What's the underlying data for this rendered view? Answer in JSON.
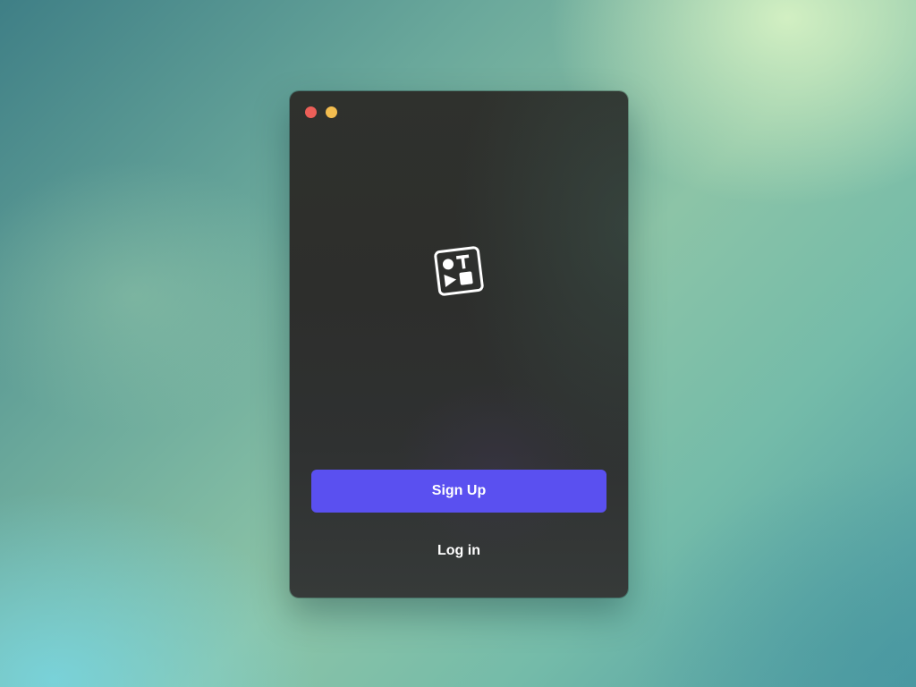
{
  "window": {
    "controls": [
      "close",
      "minimize"
    ],
    "logo_icon": "shapes-logo-icon"
  },
  "actions": {
    "signup_label": "Sign Up",
    "login_label": "Log in"
  },
  "colors": {
    "accent": "#5a50f0",
    "window_background": "#2f312d",
    "close_button": "#ec5f58",
    "minimize_button": "#f3bd4f"
  }
}
